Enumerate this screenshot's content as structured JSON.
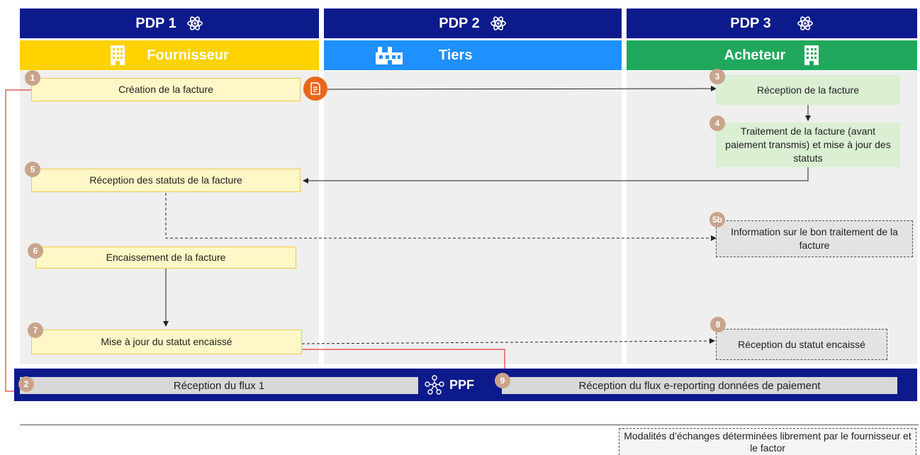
{
  "columns": [
    {
      "header": "PDP 1",
      "role": "Fournisseur"
    },
    {
      "header": "PDP 2",
      "role": "Tiers"
    },
    {
      "header": "PDP 3",
      "role": "Acheteur"
    }
  ],
  "steps": {
    "s1": {
      "num": "1",
      "label": "Création de la facture"
    },
    "s2": {
      "num": "2",
      "label": "Réception du flux 1"
    },
    "s3": {
      "num": "3",
      "label": "Réception de la facture"
    },
    "s4": {
      "num": "4",
      "label": "Traitement de la facture (avant paiement transmis) et mise à jour des statuts"
    },
    "s5": {
      "num": "5",
      "label": "Réception des statuts de la facture"
    },
    "s5b": {
      "num": "5b",
      "label": "Information sur le bon traitement de la facture"
    },
    "s6": {
      "num": "6",
      "label": "Encaissement de la facture"
    },
    "s7": {
      "num": "7",
      "label": "Mise à jour du statut encaissé"
    },
    "s8": {
      "num": "8",
      "label": "Réception du statut encaissé"
    },
    "s9": {
      "num": "9",
      "label": "Réception du flux e-reporting données de paiement"
    }
  },
  "ppf": {
    "label": "PPF"
  },
  "legend": {
    "label": "Modalités d’échanges déterminées librement par le fournisseur et le factor"
  },
  "icons": {
    "header_icon": "atom-icon",
    "supplier_icon": "building-icon",
    "third_icon": "factory-icon",
    "buyer_icon": "building-icon",
    "ppf_icon": "network-icon",
    "invoice_icon": "document-icon"
  },
  "colors": {
    "header": "#0d1a8c",
    "supplier": "#ffd200",
    "third": "#1e90ff",
    "buyer": "#1fa85c",
    "ppf_bar": "#0d1a8c",
    "arrow_red": "#e03a3a",
    "invoice_icon": "#e8671c"
  }
}
